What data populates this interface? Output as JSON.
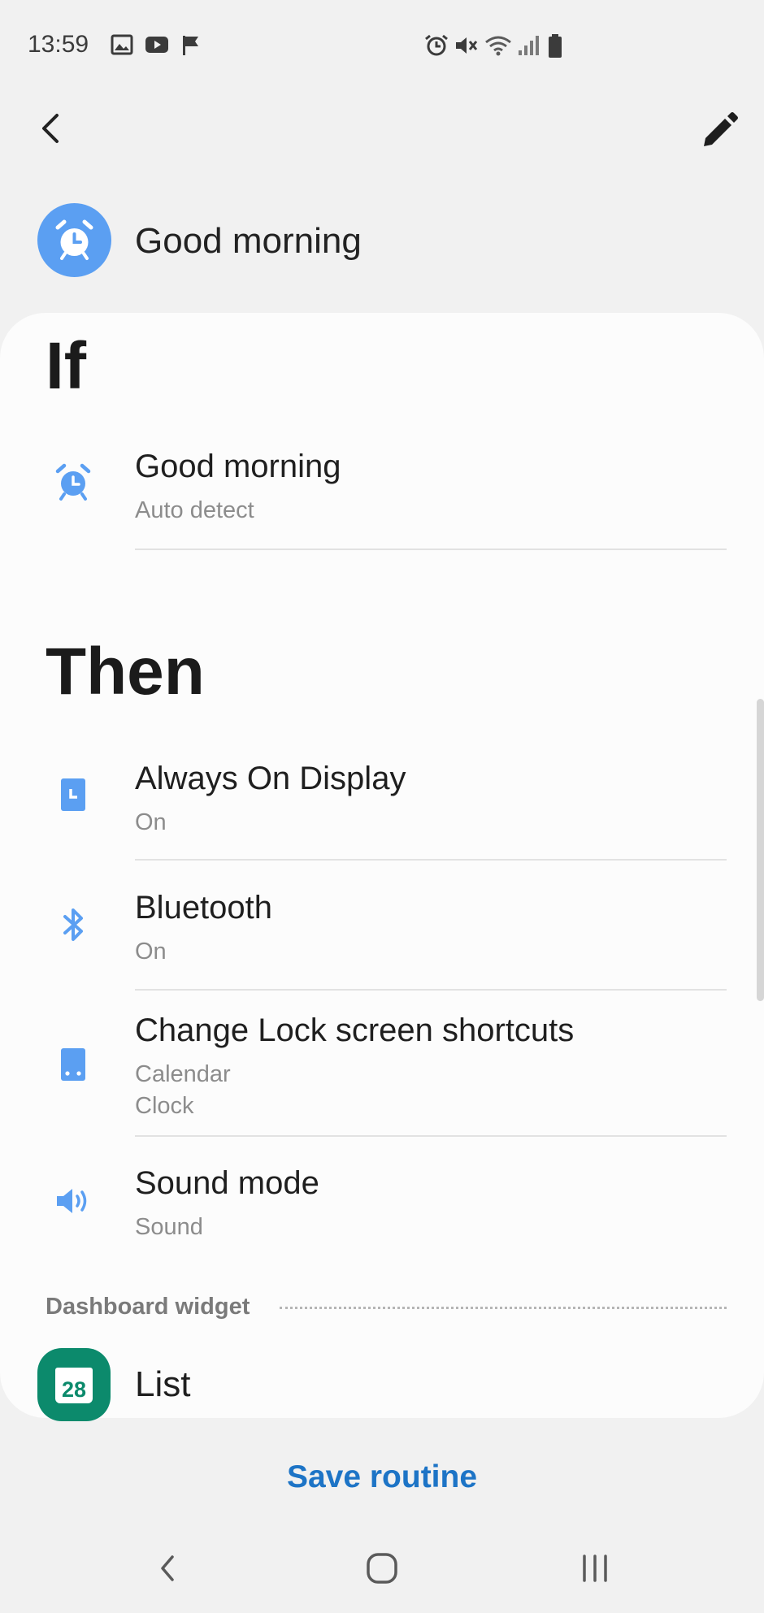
{
  "status_bar": {
    "time": "13:59",
    "left_icons": [
      "image-icon",
      "youtube-icon",
      "flag-icon"
    ],
    "right_icons": [
      "alarm-icon",
      "mute-icon",
      "wifi-icon",
      "signal-icon",
      "battery-icon"
    ]
  },
  "header": {
    "back_icon": "chevron-left-icon",
    "edit_icon": "pencil-icon",
    "routine_icon": "alarm-clock-icon",
    "routine_title": "Good morning"
  },
  "if_section": {
    "heading": "If",
    "items": [
      {
        "icon": "alarm-clock-icon",
        "title": "Good morning",
        "subtitle": "Auto detect"
      }
    ]
  },
  "then_section": {
    "heading": "Then",
    "items": [
      {
        "icon": "always-on-display-icon",
        "title": "Always On Display",
        "subtitle": "On"
      },
      {
        "icon": "bluetooth-icon",
        "title": "Bluetooth",
        "subtitle": "On"
      },
      {
        "icon": "lock-screen-shortcuts-icon",
        "title": "Change Lock screen shortcuts",
        "subtitle_lines": [
          "Calendar",
          "Clock"
        ]
      },
      {
        "icon": "sound-icon",
        "title": "Sound mode",
        "subtitle": "Sound"
      }
    ]
  },
  "dashboard": {
    "label": "Dashboard widget",
    "widget": {
      "icon": "calendar-icon",
      "icon_number": "28",
      "title": "List"
    }
  },
  "save_button": {
    "label": "Save routine"
  },
  "navigation_bar": {
    "buttons": [
      "back-nav",
      "home-nav",
      "recents-nav"
    ]
  },
  "colors": {
    "accent_icon": "#5b9ff2",
    "save_text": "#1d74c6",
    "widget_bg": "#0c8a6c",
    "background": "#f1f1f1",
    "card": "#fcfcfc"
  }
}
